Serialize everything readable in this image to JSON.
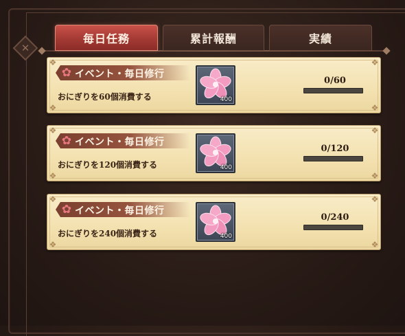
{
  "tabs": [
    {
      "label": "毎日任務",
      "active": true
    },
    {
      "label": "累計報酬",
      "active": false
    },
    {
      "label": "実績",
      "active": false
    }
  ],
  "missions": [
    {
      "category": "イベント・毎日修行",
      "description": "おにぎりを60個消費する",
      "reward_icon": "sakura-flower-icon",
      "reward_qty": "400",
      "progress_text": "0/60",
      "progress_fraction": 0
    },
    {
      "category": "イベント・毎日修行",
      "description": "おにぎりを120個消費する",
      "reward_icon": "sakura-flower-icon",
      "reward_qty": "400",
      "progress_text": "0/120",
      "progress_fraction": 0
    },
    {
      "category": "イベント・毎日修行",
      "description": "おにぎりを240個消費する",
      "reward_icon": "sakura-flower-icon",
      "reward_qty": "400",
      "progress_text": "0/240",
      "progress_fraction": 0
    }
  ],
  "colors": {
    "active_tab": "#a43a34",
    "card_bg": "#f3e1b0",
    "progress_track": "#4b4640"
  }
}
